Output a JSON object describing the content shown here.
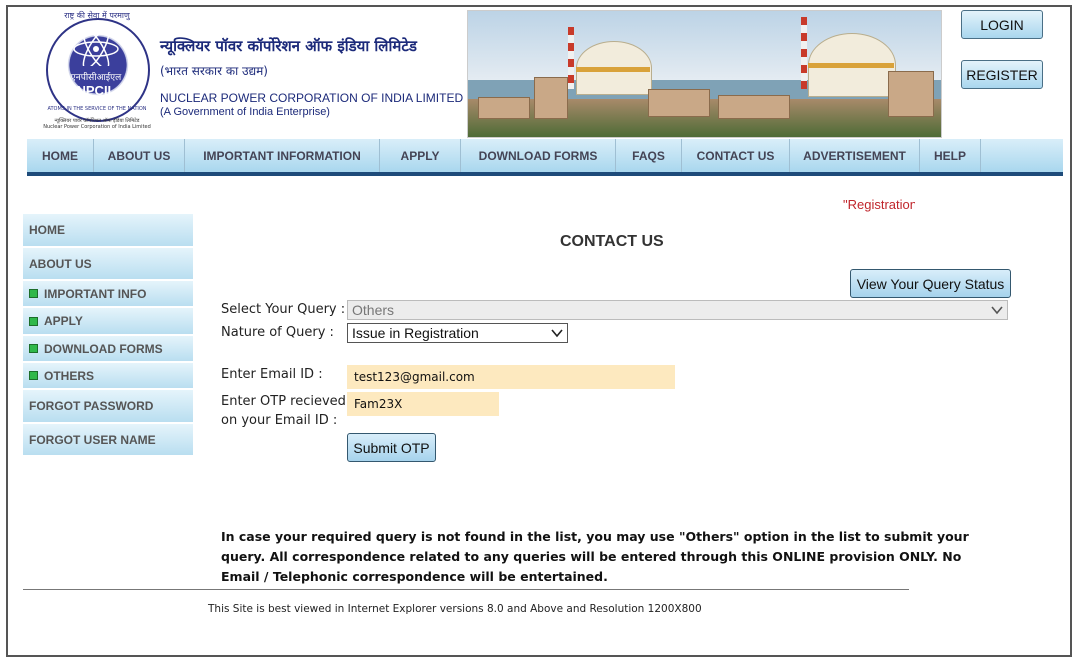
{
  "header": {
    "logo_ring_text": "राष्ट्र की सेवा में परमाणु",
    "logo_center_hindi": "एनपीसीआईएल",
    "logo_center": "NPCIL",
    "logo_ring_bottom": "ATOMS IN THE SERVICE OF THE NATION",
    "logo_foot_hindi": "न्यूक्लियर पावर कॉर्पोरेशन ऑफ इंडिया लिमिटेड",
    "logo_foot_eng": "Nuclear Power Corporation of India Limited",
    "org_name_hindi": "न्यूक्लियर पॉवर कॉर्पोरेशन ऑफ इंडिया लिमिटेड",
    "org_sub_hindi": "(भारत सरकार का उद्यम)",
    "org_name": "NUCLEAR POWER CORPORATION OF INDIA LIMITED",
    "org_sub": "(A Government of India Enterprise)",
    "login_label": "LOGIN",
    "register_label": "REGISTER"
  },
  "topnav": {
    "items": [
      {
        "label": "HOME"
      },
      {
        "label": "ABOUT US"
      },
      {
        "label": "IMPORTANT INFORMATION"
      },
      {
        "label": "APPLY"
      },
      {
        "label": "DOWNLOAD FORMS"
      },
      {
        "label": "FAQS"
      },
      {
        "label": "CONTACT US"
      },
      {
        "label": "ADVERTISEMENT"
      },
      {
        "label": "HELP"
      }
    ]
  },
  "marquee_text": "\"Registration",
  "sidebar": {
    "items": [
      {
        "label": "HOME"
      },
      {
        "label": "ABOUT US"
      },
      {
        "label": "IMPORTANT INFO"
      },
      {
        "label": "APPLY"
      },
      {
        "label": "DOWNLOAD FORMS"
      },
      {
        "label": "OTHERS"
      },
      {
        "label": "FORGOT PASSWORD"
      },
      {
        "label": "FORGOT USER NAME"
      }
    ]
  },
  "main": {
    "title": "CONTACT US",
    "status_button": "View Your Query Status",
    "select_query_label": "Select Your Query :",
    "select_query_value": "Others",
    "nature_label": "Nature of Query :",
    "nature_value": "Issue in Registration",
    "email_label": "Enter Email ID :",
    "email_value": "test123@gmail.com",
    "otp_label_line1": "Enter OTP recieved",
    "otp_label_line2": "on your Email ID :",
    "otp_value": "Fam23X",
    "submit_label": "Submit OTP",
    "notice": "In case your required query is not found in the list, you may use \"Others\" option in the list to submit your query. All correspondence related to any queries will be entered through this ONLINE provision ONLY. No Email / Telephonic correspondence will be entertained.",
    "footer_note": "This Site is best viewed in Internet Explorer versions 8.0 and Above and Resolution 1200X800"
  },
  "colors": {
    "nav_bar": "#a9d7ee",
    "nav_underline": "#1e4b7a",
    "input_fill": "#fde9bf",
    "marquee": "#c0262c",
    "bullet": "#2fb84a"
  }
}
